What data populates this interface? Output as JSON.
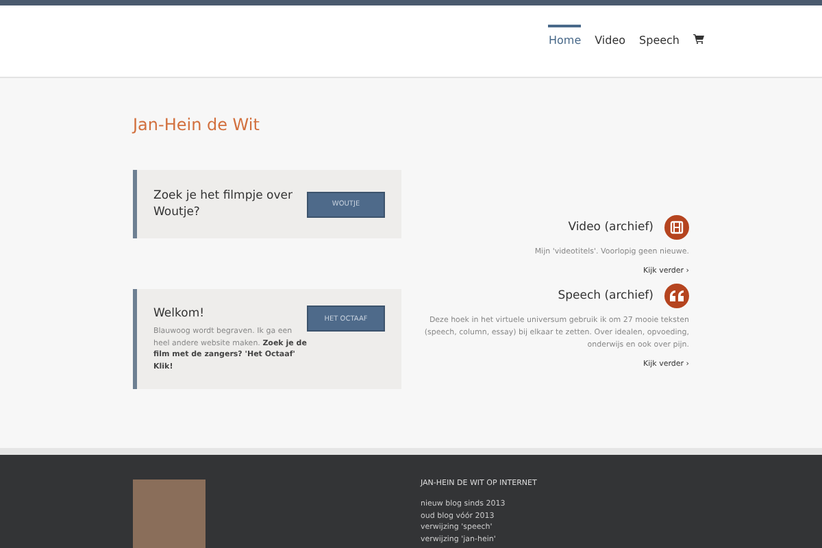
{
  "nav": {
    "items": [
      {
        "label": "Home",
        "selected": true
      },
      {
        "label": "Video",
        "selected": false
      },
      {
        "label": "Speech",
        "selected": false
      }
    ]
  },
  "title": "Jan-Hein de Wit",
  "promos": [
    {
      "heading": "Zoek je het filmpje over Woutje?",
      "button": "WOUTJE"
    },
    {
      "heading": "Welkom!",
      "text": "Blauwoog wordt begraven. Ik ga een heel andere website maken. **Zoek je de film met de zangers? 'Het Octaaf' Klik!**",
      "button": "HET OCTAAF"
    }
  ],
  "features": [
    {
      "kind": "film",
      "title": "Video (archief)",
      "text": "Mijn 'videotitels'. Voorlopig geen nieuwe.",
      "link": "Kijk verder ›"
    },
    {
      "kind": "quote",
      "title": "Speech (archief)",
      "text": "Deze hoek in het virtuele universum gebruik ik om 27 mooie teksten (speech, column, essay) bij elkaar te zetten. Over idealen, opvoeding, onderwijs en ook over pijn.",
      "link": "Kijk verder ›"
    }
  ],
  "footer": {
    "heading": "JAN-HEIN DE WIT OP INTERNET",
    "links": [
      "nieuw blog sinds 2013",
      "oud blog vóór 2013",
      "verwijzing 'speech'",
      "verwijzing 'jan-hein'"
    ]
  }
}
